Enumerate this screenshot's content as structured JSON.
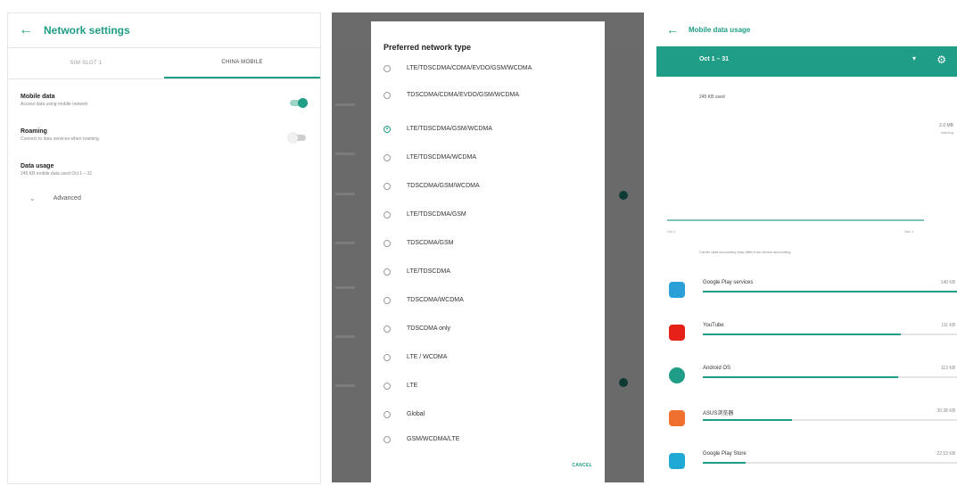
{
  "colors": {
    "accent": "#1f9d86",
    "dim": "#5a5a5a",
    "toggle_on": "#1f9d86"
  },
  "panel1": {
    "back_icon": "arrow-back-icon",
    "title": "Network settings",
    "tabs": [
      {
        "label": "SIM SLOT 1",
        "active": false
      },
      {
        "label": "CHINA MOBILE",
        "active": true
      }
    ],
    "settings": [
      {
        "title": "Mobile data",
        "subtitle": "Access data using mobile network",
        "toggle": "on"
      },
      {
        "title": "Roaming",
        "subtitle": "Connect to data services when roaming",
        "toggle": "off"
      },
      {
        "title": "Data usage",
        "subtitle": "245 KB mobile data used Oct 1 – 31"
      }
    ],
    "advanced_label": "Advanced",
    "advanced_icon": "chevron-down-icon"
  },
  "panel2": {
    "dialog_title": "Preferred network type",
    "options": [
      "LTE/TDSCDMA/CDMA/EVDO/GSM/WCDMA",
      "TDSCDMA/CDMA/EVDO/GSM/WCDMA",
      "LTE/TDSCDMA/GSM/WCDMA",
      "LTE/TDSCDMA/WCDMA",
      "TDSCDMA/GSM/WCDMA",
      "LTE/TDSCDMA/GSM",
      "TDSCDMA/GSM",
      "LTE/TDSCDMA",
      "TDSCDMA/WCDMA",
      "TDSCDMA only",
      "LTE / WCDMA",
      "LTE",
      "Global",
      "GSM/WCDMA/LTE"
    ],
    "selected_index": 2,
    "cancel_label": "CANCEL"
  },
  "panel3": {
    "back_icon": "arrow-back-icon",
    "title": "Mobile data usage",
    "sim_label": "Oct 1 – 31",
    "dropdown_icon": "dropdown-arrow-icon",
    "settings_icon": "gear-icon",
    "used_text": "245 KB used",
    "side_text_1": "2.0 MB",
    "side_text_2": "warning",
    "graph_start": "Oct 1",
    "graph_end": "Nov 1",
    "note": "Carrier data accounting may differ from device accounting",
    "apps": [
      {
        "name": "Google Play services",
        "size": "140 KB",
        "icon": "google-play-services-icon",
        "color": "#2b9fd8",
        "fraction": 1.0
      },
      {
        "name": "YouTube",
        "size": "111 KB",
        "icon": "youtube-icon",
        "color": "#e62117",
        "fraction": 0.78
      },
      {
        "name": "Android OS",
        "size": "113 KB",
        "icon": "android-os-icon",
        "color": "#1f9d86",
        "fraction": 0.77
      },
      {
        "name": "ASUS浏览器",
        "size": "30.38 KB",
        "icon": "browser-icon",
        "color": "#f07030",
        "fraction": 0.35
      },
      {
        "name": "Google Play Store",
        "size": "22.53 KB",
        "icon": "google-play-store-icon",
        "color": "#21a9d6",
        "fraction": 0.17
      }
    ]
  }
}
